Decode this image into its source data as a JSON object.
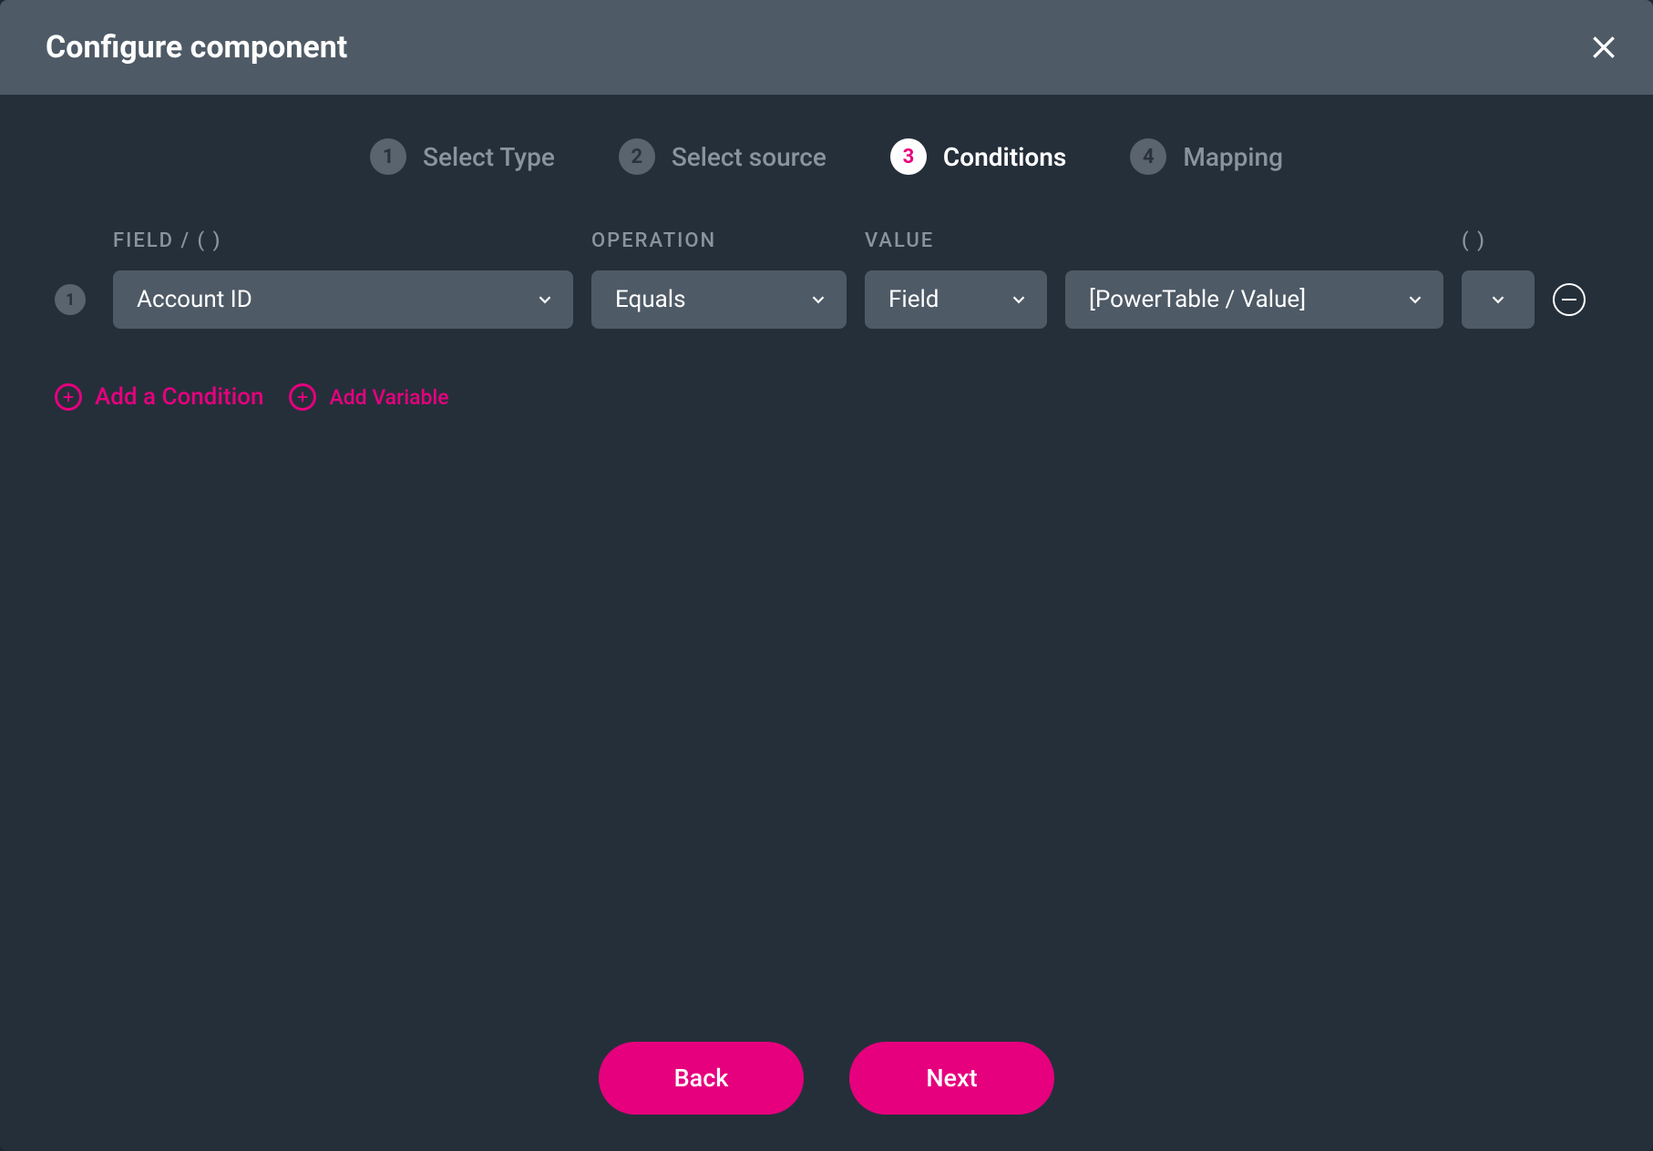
{
  "modal": {
    "title": "Configure component"
  },
  "stepper": {
    "steps": [
      {
        "num": "1",
        "label": "Select Type",
        "active": false
      },
      {
        "num": "2",
        "label": "Select source",
        "active": false
      },
      {
        "num": "3",
        "label": "Conditions",
        "active": true
      },
      {
        "num": "4",
        "label": "Mapping",
        "active": false
      }
    ]
  },
  "headers": {
    "field": "FIELD / ( )",
    "operation": "OPERATION",
    "value": "VALUE",
    "paren": "( )"
  },
  "conditions": [
    {
      "num": "1",
      "field": "Account ID",
      "operation": "Equals",
      "value_type": "Field",
      "value": "[PowerTable / Value]"
    }
  ],
  "links": {
    "add_condition": "Add a Condition",
    "add_variable": "Add Variable"
  },
  "footer": {
    "back": "Back",
    "next": "Next"
  }
}
